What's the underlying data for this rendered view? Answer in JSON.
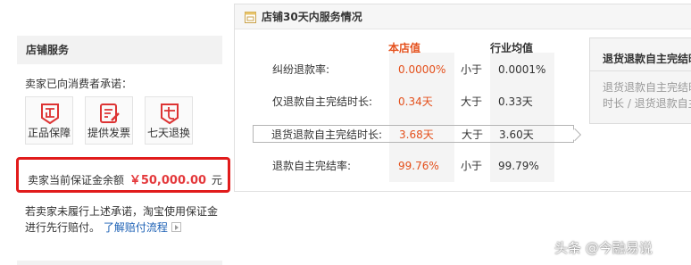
{
  "shop_service": {
    "title": "店铺服务",
    "promise_text": "卖家已向消费者承诺：",
    "icons": [
      {
        "label": "正品保障",
        "icon": "genuine-icon"
      },
      {
        "label": "提供发票",
        "icon": "invoice-icon"
      },
      {
        "label": "七天退换",
        "icon": "seven-day-return-icon"
      }
    ],
    "deposit": {
      "prefix": "卖家当前保证金余额",
      "amount": "￥50,000.00",
      "unit": "元"
    },
    "note_text": "若卖家未履行上述承诺，淘宝使用保证金进行先行赔付。",
    "note_link": "了解赔付流程"
  },
  "service_30d": {
    "title": "店铺30天内服务情况",
    "col_ours": "本店值",
    "col_industry": "行业均值",
    "rows": [
      {
        "name": "纠纷退款率:",
        "value": "0.0000%",
        "compare": "小于",
        "industry": "0.0001%"
      },
      {
        "name": "仅退款自主完结时长:",
        "value": "0.34天",
        "compare": "大于",
        "industry": "0.33天"
      },
      {
        "name": "退货退款自主完结时长:",
        "value": "3.68天",
        "compare": "大于",
        "industry": "3.60天"
      },
      {
        "name": "退款自主完结率:",
        "value": "99.76%",
        "compare": "小于",
        "industry": "99.79%"
      }
    ]
  },
  "tooltip": {
    "title": "退货退款自主完结时",
    "line1": "退货退款自主完结时",
    "line2": "时长 / 退货退款自主完"
  },
  "watermark": "头条 @今融易说",
  "colors": {
    "accent_orange": "#e4501c",
    "highlight_red": "#e11b1b",
    "link_blue": "#1a5fb4"
  }
}
